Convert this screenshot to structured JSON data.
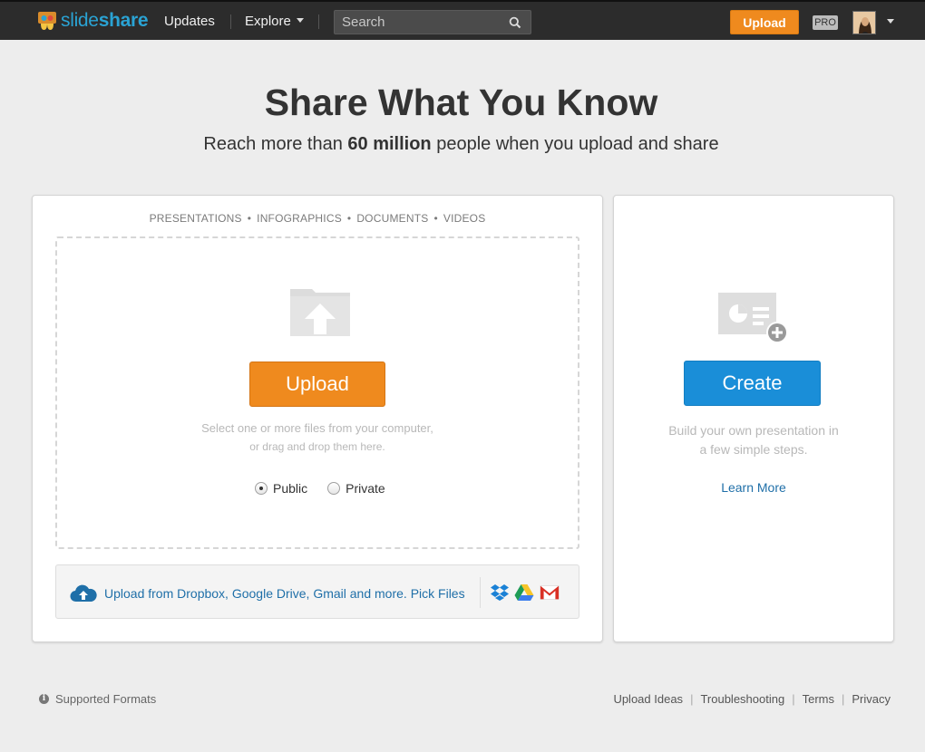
{
  "colors": {
    "topbar": "#2c2c2c",
    "accent_orange": "#ef8a1e",
    "accent_blue": "#1a8ed8",
    "link_blue": "#1f6fa8",
    "brand": "#2aa3d4"
  },
  "header": {
    "logo_prefix": "slide",
    "logo_suffix": "share",
    "nav": {
      "updates": "Updates",
      "explore": "Explore"
    },
    "search_placeholder": "Search",
    "upload_label": "Upload",
    "pro_label": "PRO"
  },
  "hero": {
    "title": "Share What You Know",
    "subtitle_pre": "Reach more than ",
    "subtitle_bold": "60 million",
    "subtitle_post": " people when you upload and share"
  },
  "upload_panel": {
    "types": [
      "PRESENTATIONS",
      "INFOGRAPHICS",
      "DOCUMENTS",
      "VIDEOS"
    ],
    "button": "Upload",
    "hint_line1": "Select one or more files from your computer,",
    "hint_line2": "or drag and drop them here.",
    "visibility": {
      "public": "Public",
      "private": "Private",
      "selected": "public"
    },
    "cloud_text": "Upload from Dropbox, Google Drive, Gmail and more. Pick Files",
    "services": [
      "dropbox-icon",
      "google-drive-icon",
      "gmail-icon"
    ]
  },
  "create_panel": {
    "button": "Create",
    "hint_line1": "Build your own presentation in",
    "hint_line2": "a few simple steps.",
    "learn_more": "Learn More"
  },
  "footer": {
    "supported_formats": "Supported Formats",
    "links": [
      "Upload Ideas",
      "Troubleshooting",
      "Terms",
      "Privacy"
    ]
  }
}
